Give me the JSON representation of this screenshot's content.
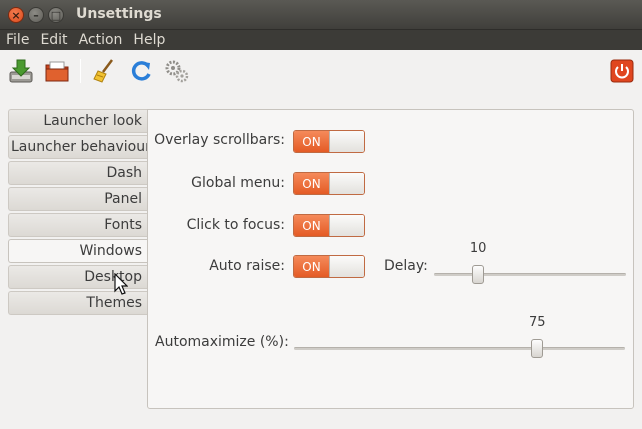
{
  "window": {
    "title": "Unsettings",
    "close_glyph": "×",
    "min_glyph": "–",
    "max_glyph": "□"
  },
  "menu": [
    "File",
    "Edit",
    "Action",
    "Help"
  ],
  "toolbar": {
    "icons": [
      "download-icon",
      "open-folder-icon",
      "broom-icon",
      "refresh-icon",
      "gears-icon",
      "power-icon"
    ],
    "colors": {
      "power": "#e0461f",
      "refresh": "#2a7ed8",
      "download": "#4a9a2f"
    }
  },
  "tabs": [
    "Launcher look",
    "Launcher behaviour",
    "Dash",
    "Panel",
    "Fonts",
    "Windows",
    "Desktop",
    "Themes"
  ],
  "active_tab": "Windows",
  "settings": {
    "overlay_scrollbars": {
      "label": "Overlay scrollbars:",
      "state": "ON"
    },
    "global_menu": {
      "label": "Global menu:",
      "state": "ON"
    },
    "click_to_focus": {
      "label": "Click to focus:",
      "state": "ON"
    },
    "auto_raise": {
      "label": "Auto raise:",
      "state": "ON"
    },
    "delay": {
      "label": "Delay:",
      "value": "10",
      "fraction": 0.23
    },
    "automaximize": {
      "label": "Automaximize  (%):",
      "value": "75",
      "fraction": 0.735
    }
  },
  "accent": "#e95420"
}
